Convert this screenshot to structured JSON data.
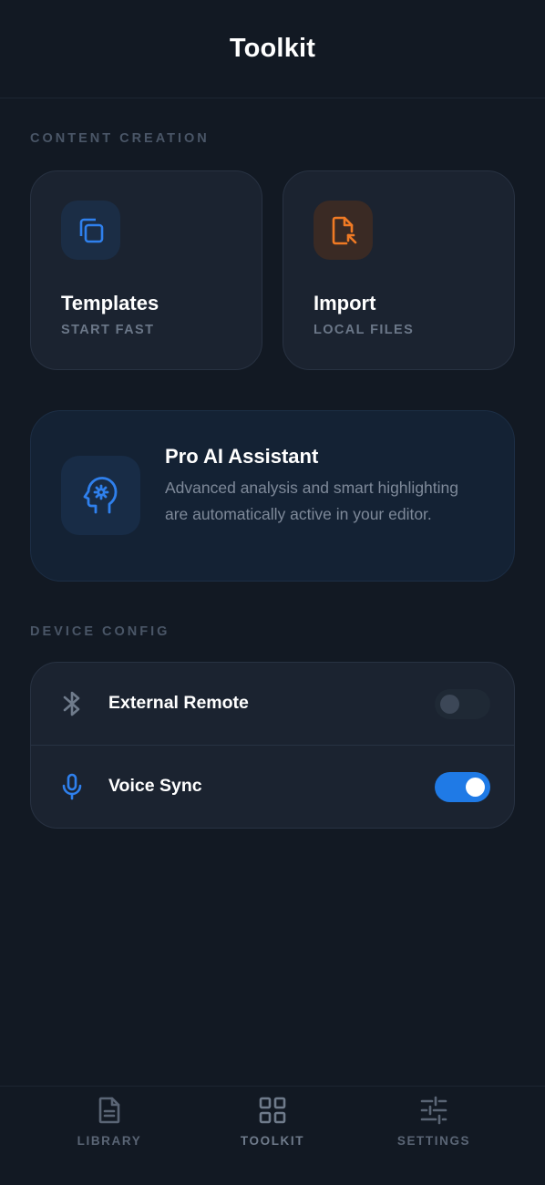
{
  "header": {
    "title": "Toolkit"
  },
  "sections": {
    "content_creation": "CONTENT CREATION",
    "device_config": "DEVICE CONFIG"
  },
  "cards": [
    {
      "title": "Templates",
      "subtitle": "START FAST",
      "icon": "copy-icon",
      "accent": "#2f80ed",
      "tile": "#1b2d45"
    },
    {
      "title": "Import",
      "subtitle": "LOCAL FILES",
      "icon": "file-import-icon",
      "accent": "#f07a24",
      "tile": "#3a2a24"
    }
  ],
  "ai_card": {
    "title": "Pro AI Assistant",
    "description": "Advanced analysis and smart highlighting are automatically active in your editor.",
    "icon": "ai-head-gear-icon",
    "accent": "#2f80ed"
  },
  "config": [
    {
      "label": "External Remote",
      "icon": "bluetooth-icon",
      "enabled": false
    },
    {
      "label": "Voice Sync",
      "icon": "microphone-icon",
      "enabled": true
    }
  ],
  "tabs": [
    {
      "label": "LIBRARY",
      "icon": "document-icon",
      "active": false
    },
    {
      "label": "TOOLKIT",
      "icon": "grid-icon",
      "active": true
    },
    {
      "label": "SETTINGS",
      "icon": "sliders-icon",
      "active": false
    }
  ],
  "colors": {
    "background": "#121923",
    "surface": "#1b2330",
    "accent_blue": "#1f7ae6",
    "accent_orange": "#f07a24",
    "muted_text": "#7e8999",
    "tab_inactive": "#5a6575",
    "tab_active": "#6f7b8b"
  }
}
